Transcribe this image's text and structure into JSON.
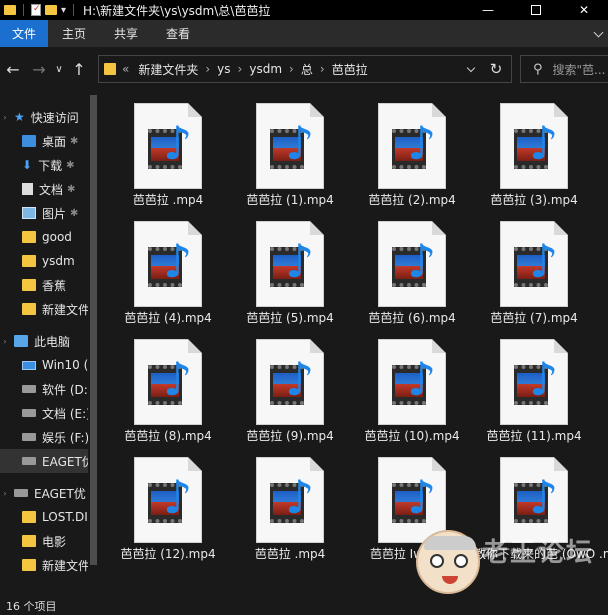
{
  "window": {
    "title": "H:\\新建文件夹\\ys\\ysdm\\总\\芭芭拉",
    "minimize": "—",
    "close": "✕"
  },
  "ribbon": {
    "tabs": [
      "文件",
      "主页",
      "共享",
      "查看"
    ]
  },
  "nav": {
    "back": "←",
    "forward": "→",
    "recent": "∨",
    "up": "↑"
  },
  "address": {
    "overflow": "«",
    "crumbs": [
      "新建文件夹",
      "ys",
      "ysdm",
      "总",
      "芭芭拉"
    ],
    "separator": "›",
    "refresh": "↻"
  },
  "search": {
    "placeholder": "搜索\"芭..."
  },
  "sidebar": {
    "items": [
      {
        "label": "快速访问",
        "icon": "star-icon"
      },
      {
        "label": "桌面",
        "icon": "desktop-icon",
        "pinned": true
      },
      {
        "label": "下载",
        "icon": "download-icon",
        "pinned": true
      },
      {
        "label": "文档",
        "icon": "document-icon",
        "pinned": true
      },
      {
        "label": "图片",
        "icon": "pictures-icon",
        "pinned": true
      },
      {
        "label": "good",
        "icon": "folder-icon"
      },
      {
        "label": "ysdm",
        "icon": "folder-icon"
      },
      {
        "label": "香蕉",
        "icon": "folder-icon"
      },
      {
        "label": "新建文件",
        "icon": "folder-icon"
      },
      {
        "label": "此电脑",
        "icon": "computer-icon"
      },
      {
        "label": "Win10 (",
        "icon": "windows-drive-icon"
      },
      {
        "label": "软件 (D:",
        "icon": "drive-icon"
      },
      {
        "label": "文档 (E:)",
        "icon": "drive-icon"
      },
      {
        "label": "娱乐 (F:)",
        "icon": "drive-icon"
      },
      {
        "label": "EAGET优",
        "icon": "drive-icon"
      },
      {
        "label": "EAGET优",
        "icon": "drive-icon"
      },
      {
        "label": "LOST.DI",
        "icon": "folder-icon"
      },
      {
        "label": "电影",
        "icon": "folder-icon"
      },
      {
        "label": "新建文件",
        "icon": "folder-icon"
      }
    ],
    "pin_glyph": "📌",
    "expand_glyph": "›",
    "collapse_glyph": "›"
  },
  "files": [
    "芭芭拉 .mp4",
    "芭芭拉 (1).mp4",
    "芭芭拉 (2).mp4",
    "芭芭拉 (3).mp4",
    "芭芭拉 (4).mp4",
    "芭芭拉 (5).mp4",
    "芭芭拉 (6).mp4",
    "芭芭拉 (7).mp4",
    "芭芭拉 (8).mp4",
    "芭芭拉 (9).mp4",
    "芭芭拉 (10).mp4",
    "芭芭拉 (11).mp4",
    "芭芭拉 (12).mp4",
    "芭芭拉 .mp4",
    "芭芭拉 Iwara...",
    "教你下载来的芭 (OwO .mp4"
  ],
  "status": {
    "count": "16 个项目"
  },
  "watermark": {
    "text": "老王论坛"
  },
  "colors": {
    "accent": "#1a6fcf",
    "background": "#191919",
    "folder": "#f5c542",
    "note": "#1e86e8"
  }
}
